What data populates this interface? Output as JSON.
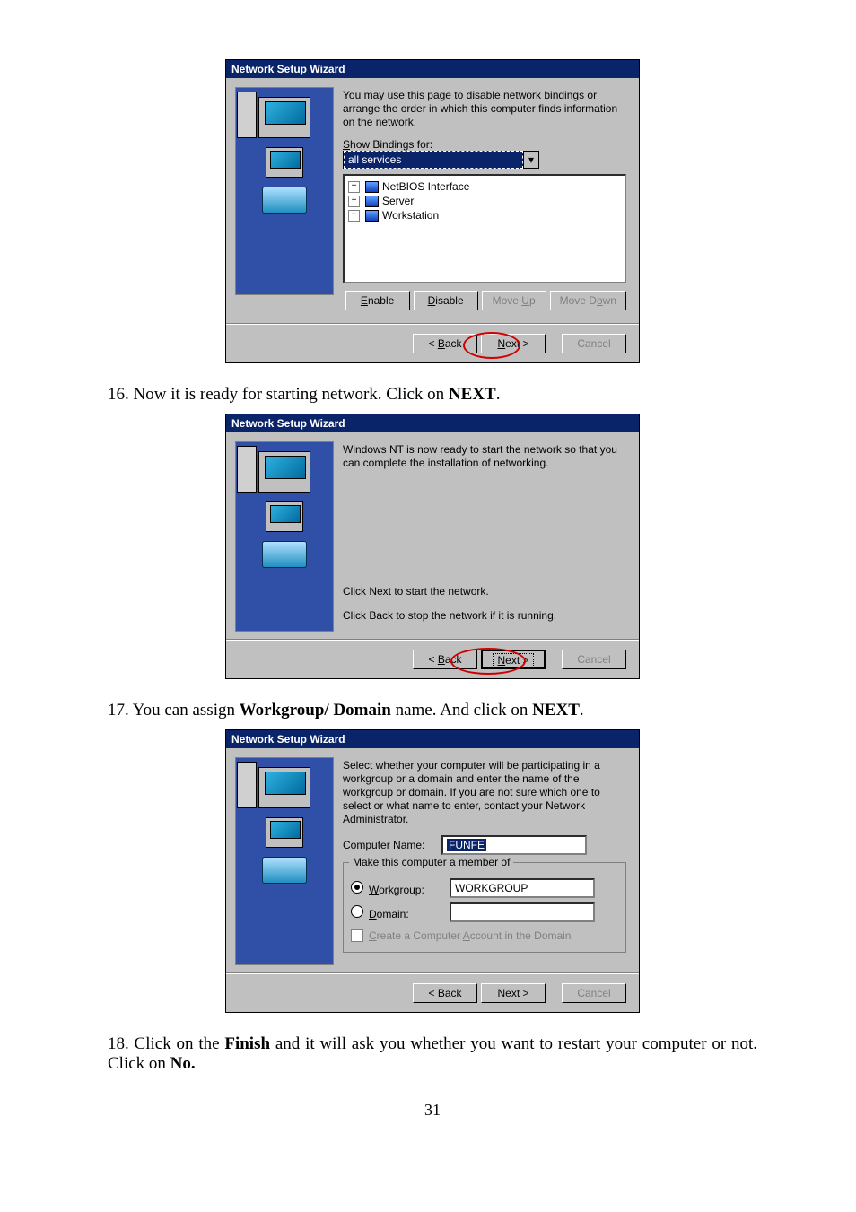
{
  "dialog1": {
    "title": "Network Setup Wizard",
    "desc": "You may use this page to disable network bindings or arrange the order in which this computer finds information on the network.",
    "bindings_label": "Show Bindings for:",
    "bindings_value": "all services",
    "tree": [
      "NetBIOS Interface",
      "Server",
      "Workstation"
    ],
    "enable": "Enable",
    "disable": "Disable",
    "moveup": "Move Up",
    "movedown": "Move Down",
    "back": "< Back",
    "next": "Next >",
    "cancel": "Cancel"
  },
  "step16": "16. Now it is ready for starting network. Click on ",
  "step16_bold": "NEXT",
  "step16_end": ".",
  "dialog2": {
    "title": "Network Setup Wizard",
    "line1": "Windows NT is now ready to start the network so that you can complete the installation of networking.",
    "line2": "Click Next to start the network.",
    "line3": "Click Back to stop the network if it is running.",
    "back": "< Back",
    "next": "Next >",
    "cancel": "Cancel"
  },
  "step17": "17. You can assign ",
  "step17_bold": "Workgroup/ Domain",
  "step17_mid": " name. And click on ",
  "step17_bold2": "NEXT",
  "step17_end": ".",
  "dialog3": {
    "title": "Network Setup Wizard",
    "desc": "Select whether your computer will be participating in a workgroup or a domain and enter the name of the workgroup or domain. If you are not sure which one to select or what name to enter, contact your Network Administrator.",
    "comp_label": "Computer Name:",
    "comp_value": "FUNFE",
    "group_title": "Make this computer a member of",
    "workgroup_label": "Workgroup:",
    "workgroup_value": "WORKGROUP",
    "domain_label": "Domain:",
    "create_label": "Create a Computer Account in the Domain",
    "back": "< Back",
    "next": "Next >",
    "cancel": "Cancel"
  },
  "step18": "18. Click on the ",
  "step18_bold": "Finish",
  "step18_mid": " and it will ask you whether you want to restart your computer or     not. Click on ",
  "step18_bold2": "No.",
  "pagenum": "31"
}
